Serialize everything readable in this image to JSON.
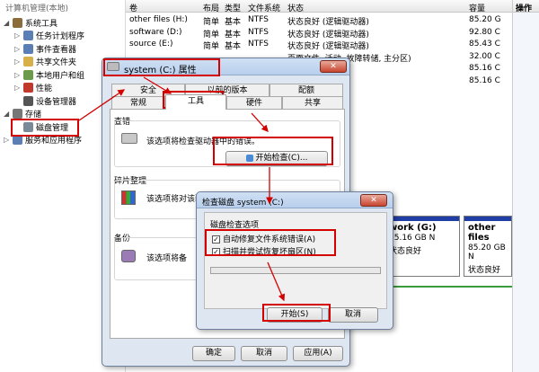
{
  "tree": {
    "top_label": "计算机管理(本地)",
    "items": [
      {
        "label": "系统工具",
        "indent": 0,
        "twisty": "◢",
        "color": "#8a6d3b"
      },
      {
        "label": "任务计划程序",
        "indent": 1,
        "twisty": "▷",
        "color": "#5b7fb5"
      },
      {
        "label": "事件查看器",
        "indent": 1,
        "twisty": "▷",
        "color": "#5b7fb5"
      },
      {
        "label": "共享文件夹",
        "indent": 1,
        "twisty": "▷",
        "color": "#d8b04a"
      },
      {
        "label": "本地用户和组",
        "indent": 1,
        "twisty": "▷",
        "color": "#6b9a4a"
      },
      {
        "label": "性能",
        "indent": 1,
        "twisty": "▷",
        "color": "#c0392b"
      },
      {
        "label": "设备管理器",
        "indent": 1,
        "twisty": "",
        "color": "#555"
      },
      {
        "label": "存储",
        "indent": 0,
        "twisty": "◢",
        "color": "#777"
      },
      {
        "label": "磁盘管理",
        "indent": 1,
        "twisty": "",
        "color": "#7a8a99"
      },
      {
        "label": "服务和应用程序",
        "indent": 0,
        "twisty": "▷",
        "color": "#5b7fb5"
      }
    ]
  },
  "table": {
    "headers": [
      "卷",
      "布局",
      "类型",
      "文件系统",
      "状态",
      "容量"
    ],
    "rows": [
      {
        "vol": "other files (H:)",
        "layout": "简单",
        "type": "基本",
        "fs": "NTFS",
        "status": "状态良好 (逻辑驱动器)",
        "cap": "85.20 G"
      },
      {
        "vol": "software (D:)",
        "layout": "简单",
        "type": "基本",
        "fs": "NTFS",
        "status": "状态良好 (逻辑驱动器)",
        "cap": "92.80 C"
      },
      {
        "vol": "source (E:)",
        "layout": "简单",
        "type": "基本",
        "fs": "NTFS",
        "status": "状态良好 (逻辑驱动器)",
        "cap": "85.43 C"
      },
      {
        "vol": "",
        "layout": "",
        "type": "",
        "fs": "",
        "status": "页面文件, 活动, 故障转储, 主分区)",
        "cap": "32.00 C"
      },
      {
        "vol": "",
        "layout": "",
        "type": "",
        "fs": "",
        "status": "",
        "cap": "85.16 C"
      },
      {
        "vol": "",
        "layout": "",
        "type": "",
        "fs": "",
        "status": "",
        "cap": "85.16 C"
      }
    ]
  },
  "ops": {
    "header": "操作"
  },
  "diskmap": {
    "volumes": [
      {
        "name": "",
        "size": "",
        "status": ""
      },
      {
        "name": "work (G:)",
        "size": "85.16 GB N",
        "status": "状态良好"
      },
      {
        "name": "other files",
        "size": "85.20 GB N",
        "status": "状态良好"
      }
    ]
  },
  "props": {
    "title": "system (C:) 属性",
    "close": "✕",
    "tabs_row1": [
      "安全",
      "以前的版本",
      "配额"
    ],
    "tabs_row2": [
      "常规",
      "工具",
      "硬件",
      "共享"
    ],
    "check": {
      "header": "查错",
      "text": "该选项将检查驱动器中的错误。",
      "button": "开始检查(C)..."
    },
    "defrag": {
      "header": "碎片整理",
      "text": "该选项将对该驱动器中的文件进行碎片整理。"
    },
    "backup": {
      "header": "备份",
      "text": "该选项将备"
    },
    "buttons": {
      "ok": "确定",
      "cancel": "取消",
      "apply": "应用(A)"
    }
  },
  "chk": {
    "title": "检查磁盘 system (C:)",
    "close": "✕",
    "group": "磁盘检查选项",
    "opt1": "自动修复文件系统错误(A)",
    "opt2": "扫描并尝试恢复坏扇区(N)",
    "check_mark": "✓",
    "start": "开始(S)",
    "cancel": "取消"
  }
}
